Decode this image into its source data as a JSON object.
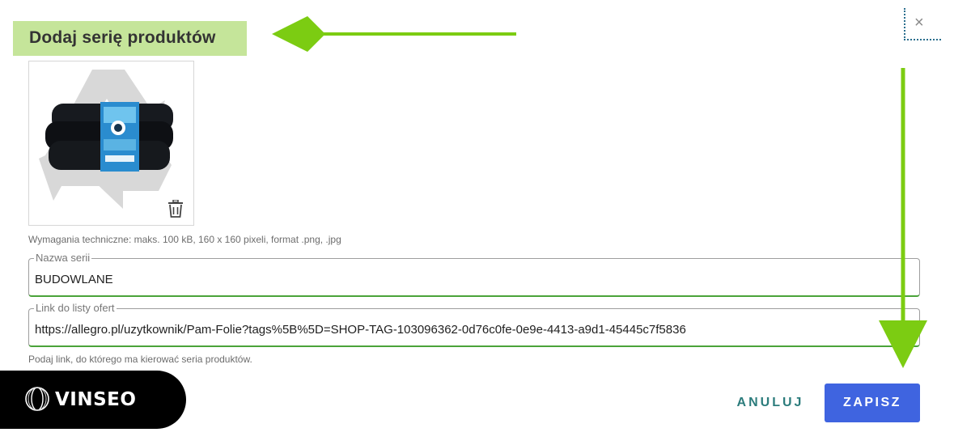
{
  "dialog": {
    "title": "Dodaj serię produktów",
    "close_glyph": "×",
    "image_hint": "Wymagania techniczne: maks. 100 kB, 160 x 160 pixeli, format .png, .jpg",
    "series_name": {
      "label": "Nazwa serii",
      "value": "BUDOWLANE"
    },
    "offers_link": {
      "label": "Link do listy ofert",
      "value": "https://allegro.pl/uzytkownik/Pam-Folie?tags%5B%5D=SHOP-TAG-103096362-0d76c0fe-0e9e-4413-a9d1-45445c7f5836",
      "hint": "Podaj link, do którego ma kierować seria produktów."
    },
    "cancel_label": "ANULUJ",
    "save_label": "ZAPISZ"
  },
  "branding": {
    "name": "VINSEO"
  },
  "colors": {
    "title_highlight": "#c5e59a",
    "annotation_arrow": "#7ccc12",
    "save_button": "#3f64e0",
    "cancel_text": "#2c7c7c",
    "field_underline": "#4aa33a"
  },
  "icons": [
    "close-icon",
    "recycle-icon",
    "trash-icon",
    "vinseo-logo-icon"
  ]
}
